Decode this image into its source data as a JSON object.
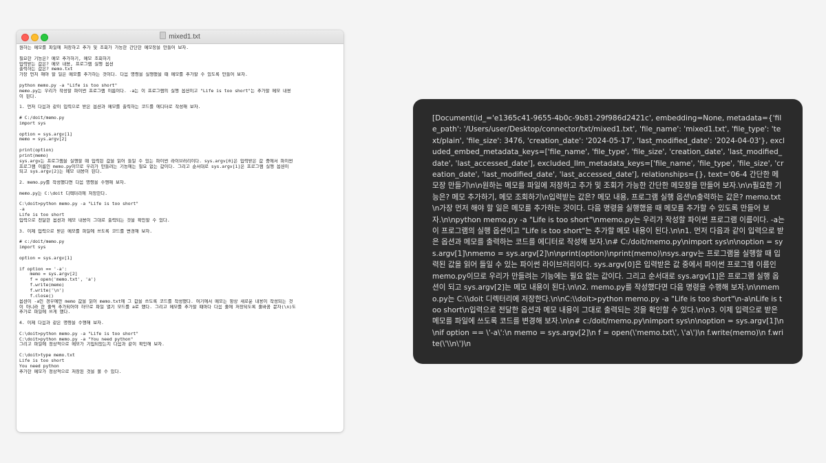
{
  "window": {
    "title": "mixed1.txt"
  },
  "editor": {
    "lines": [
      "원하는 메모를 파일에 저장하고 추가 및 조회가 가능한 간단한 메모장을 만들어 보자.",
      "",
      "필요한 기능은? 메모 추가하기, 메모 조회하기",
      "입력받는 값은? 메모 내용, 프로그램 실행 옵션",
      "출력하는 값은? memo.txt",
      "가장 먼저 해야 할 일은 메모를 추가하는 것이다. 다음 명령을 실행했을 때 메모를 추가할 수 있도록 만들어 보자.",
      "",
      "python memo.py -a \"Life is too short\"",
      "memo.py는 우리가 작성할 파이썬 프로그램 이름이다. -a는 이 프로그램의 실행 옵션이고 \"Life is too short\"는 추가할 메모 내용",
      "이 된다.",
      "",
      "1. 먼저 다음과 같이 입력으로 받은 옵션과 메모를 출력하는 코드를 에디터로 작성해 보자.",
      "",
      "# C:/doit/memo.py",
      "import sys",
      "",
      "option = sys.argv[1]",
      "memo = sys.argv[2]",
      "",
      "print(option)",
      "print(memo)",
      "sys.argv는 프로그램을 실행할 때 입력된 값을 읽어 들일 수 있는 파이썬 라이브러리이다. sys.argv[0]은 입력받은 값 중에서 파이썬",
      "프로그램 이름인 memo.py이므로 우리가 만들려는 기능에는 필요 없는 값이다. 그리고 순서대로 sys.argv[1]은 프로그램 실행 옵션이",
      "되고 sys.argv[2]는 메모 내용이 된다.",
      "",
      "2. memo.py를 작성했다면 다음 명령을 수행해 보자.",
      "",
      "memo.py는 C:\\doit 디렉터리에 저장한다.",
      "",
      "C:\\doit>python memo.py -a \"Life is too short\"",
      "-a",
      "Life is too short",
      "입력으로 전달한 옵션과 메모 내용이 그대로 출력되는 것을 확인할 수 있다.",
      "",
      "3. 이제 입력으로 받은 메모를 파일에 쓰도록 코드를 변경해 보자.",
      "",
      "# c:/doit/memo.py",
      "import sys",
      "",
      "option = sys.argv[1]",
      "",
      "if option == '-a':",
      "    memo = sys.argv[2]",
      "    f = open('memo.txt', 'a')",
      "    f.write(memo)",
      "    f.write('\\n')",
      "    f.close()",
      "옵션이 -a인 경우에만 memo 값을 읽어 memo.txt에 그 값을 쓰도록 코드를 작성했다. 여기에서 메모는 항상 새로운 내용이 작성되는 것",
      "이 아니라 한 줄씩 추가되어야 하므로 파일 열기 모드를 a로 했다. 그리고 메모를 추가할 때마다 다음 줄에 저장되도록 줄바꿈 문자(\\n)도",
      "추가로 파일에 쓰게 했다.",
      "",
      "4. 이제 다음과 같은 명령을 수행해 보자.",
      "",
      "C:\\doit>python memo.py -a \"Life is too short\"",
      "C:\\doit>python memo.py -a \"You need python\"",
      "그리고 파일에 정상적으로 메모가 기입되었는지 다음과 같이 확인해 보자.",
      "",
      "C:\\doit>type memo.txt",
      "Life is too short",
      "You need python",
      "추가한 메모가 정상적으로 저장된 것을 볼 수 있다."
    ]
  },
  "output": {
    "text": "[Document(id_='e1365c41-9655-4b0c-9b81-29f986d2421c', embedding=None, metadata={'file_path': '/Users/user/Desktop/connector/txt/mixed1.txt', 'file_name': 'mixed1.txt', 'file_type': 'text/plain', 'file_size': 3476, 'creation_date': '2024-05-17', 'last_modified_date': '2024-04-03'}, excluded_embed_metadata_keys=['file_name', 'file_type', 'file_size', 'creation_date', 'last_modified_date', 'last_accessed_date'], excluded_llm_metadata_keys=['file_name', 'file_type', 'file_size', 'creation_date', 'last_modified_date', 'last_accessed_date'], relationships={}, text='06-4 간단한 메모장 만들기\\n\\n원하는 메모를 파일에 저장하고 추가 및 조회가 가능한 간단한 메모장을 만들어 보자.\\n\\n필요한 기능은? 메모 추가하기, 메모 조회하기\\n입력받는 값은? 메모 내용, 프로그램 실행 옵션\\n출력하는 값은? memo.txt\\n가장 먼저 해야 할 일은 메모를 추가하는 것이다. 다음 명령을 실행했을 때 메모를 추가할 수 있도록 만들어 보자.\\n\\npython memo.py -a \"Life is too short\"\\nmemo.py는 우리가 작성할 파이썬 프로그램 이름이다. -a는 이 프로그램의 실행 옵션이고 \"Life is too short\"는 추가할 메모 내용이 된다.\\n\\n1. 먼저 다음과 같이 입력으로 받은 옵션과 메모를 출력하는 코드를 에디터로 작성해 보자.\\n# C:/doit/memo.py\\nimport sys\\n\\noption = sys.argv[1]\\nmemo = sys.argv[2]\\n\\nprint(option)\\nprint(memo)\\nsys.argv는 프로그램을 실행할 때 입력된 값을 읽어 들일 수 있는 파이썬 라이브러리이다. sys.argv[0]은 입력받은 값 중에서 파이썬 프로그램 이름인 memo.py이므로 우리가 만들려는 기능에는 필요 없는 값이다. 그리고 순서대로 sys.argv[1]은 프로그램 실행 옵션이 되고 sys.argv[2]는 메모 내용이 된다.\\n\\n2. memo.py를 작성했다면 다음 명령을 수행해 보자.\\n\\nmemo.py는 C:\\\\doit 디렉터리에 저장한다.\\n\\nC:\\\\doit>python memo.py -a \"Life is too short\"\\n-a\\nLife is too short\\n입력으로 전달한 옵션과 메모 내용이 그대로 출력되는 것을 확인할 수 있다.\\n\\n3. 이제 입력으로 받은 메모를 파일에 쓰도록 코드를 변경해 보자.\\n\\n# c:/doit/memo.py\\nimport sys\\n\\noption = sys.argv[1]\\n\\nif option == \\'-a\\':\\n    memo = sys.argv[2]\\n    f = open(\\'memo.txt\\', \\'a\\')\\n    f.write(memo)\\n    f.write(\\'\\\\n\\')\\n"
  }
}
